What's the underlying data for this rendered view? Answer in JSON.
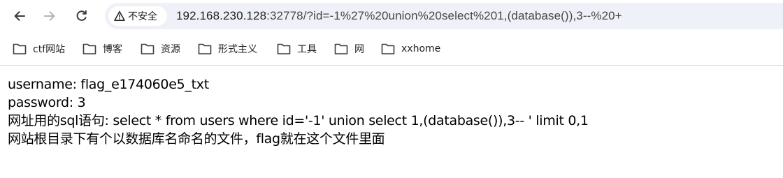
{
  "browser": {
    "security_label": "不安全",
    "url_host": "192.168.230.128",
    "url_rest": ":32778/?id=-1%27%20union%20select%201,(database()),3--%20+",
    "icons": {
      "back": "arrow-left-icon",
      "forward": "arrow-right-icon",
      "reload": "reload-icon",
      "security": "warning-triangle-icon",
      "bookmark_folder": "folder-icon"
    }
  },
  "bookmarks": [
    {
      "label": "ctf网站"
    },
    {
      "label": "博客"
    },
    {
      "label": "资源"
    },
    {
      "label": "形式主义"
    },
    {
      "label": "工具"
    },
    {
      "label": "网"
    },
    {
      "label": "xxhome"
    }
  ],
  "page": {
    "lines": [
      "username: flag_e174060e5_txt",
      "password: 3",
      "网址用的sql语句: select * from users where id='-1' union select 1,(database()),3-- ' limit 0,1",
      "网站根目录下有个以数据库名命名的文件，flag就在这个文件里面"
    ]
  }
}
